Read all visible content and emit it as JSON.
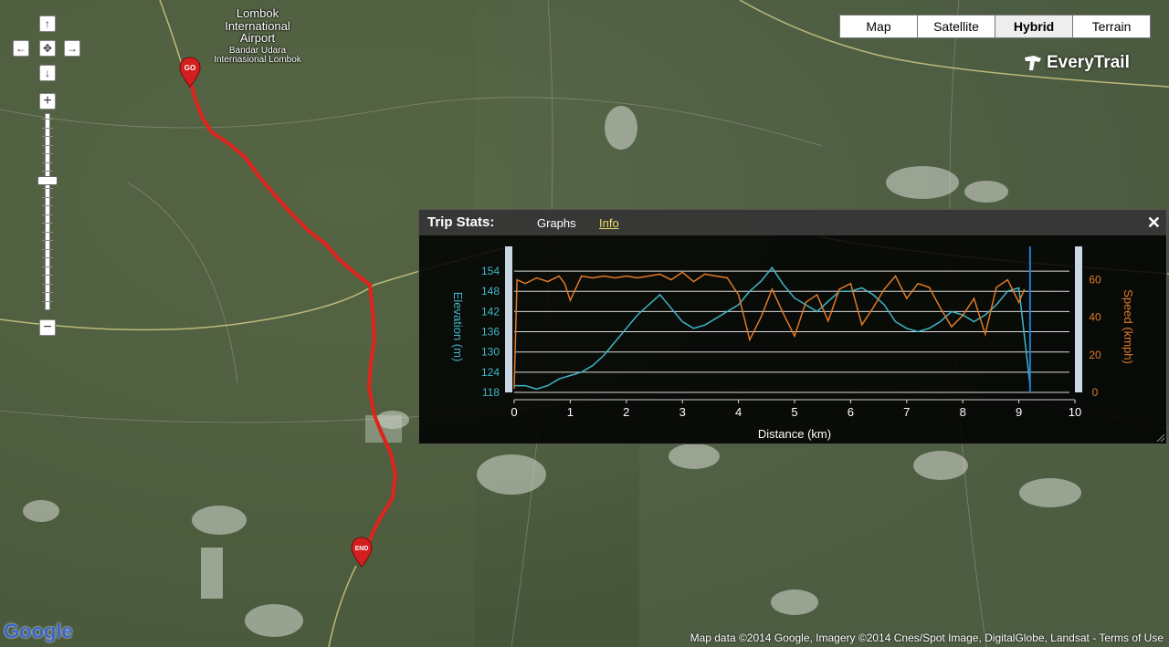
{
  "map": {
    "airport_name": "Lombok International Airport",
    "airport_name_local": "Bandar Udara Internasional Lombok",
    "start_pin": "GO",
    "end_pin": "END",
    "route_color": "#e0231c"
  },
  "map_types": [
    {
      "label": "Map",
      "active": false
    },
    {
      "label": "Satellite",
      "active": false
    },
    {
      "label": "Hybrid",
      "active": true
    },
    {
      "label": "Terrain",
      "active": false
    }
  ],
  "brand": "EveryTrail",
  "panel": {
    "title": "Trip Stats:",
    "tab_graphs": "Graphs",
    "tab_info": "Info",
    "close": "✕"
  },
  "attribution": {
    "text": "Map data ©2014  Google, Imagery ©2014  Cnes/Spot Image, DigitalGlobe, Landsat - ",
    "terms": "Terms of Use"
  },
  "google_logo": "Google",
  "icons": [
    "pan-up-icon",
    "pan-left-icon",
    "pan-center-icon",
    "pan-right-icon",
    "pan-down-icon",
    "zoom-in-icon",
    "zoom-out-icon",
    "close-icon"
  ],
  "chart_data": {
    "type": "line",
    "xlabel": "Distance (km)",
    "ylabel": "Elevation (m)",
    "y2label": "Speed (kmph)",
    "xlim": [
      0,
      10
    ],
    "ylim": [
      118,
      157
    ],
    "y2lim": [
      0,
      70
    ],
    "x_ticks": [
      "0",
      "1",
      "2",
      "3",
      "4",
      "5",
      "6",
      "7",
      "8",
      "9",
      "10"
    ],
    "y_ticks": [
      "118",
      "124",
      "130",
      "136",
      "142",
      "148",
      "154"
    ],
    "y2_ticks": [
      "0",
      "20",
      "40",
      "60"
    ],
    "marker_x": 9.2,
    "colors": {
      "elevation": "#3fb6c8",
      "speed": "#e07a2a",
      "marker": "#1f7fd6"
    },
    "series": [
      {
        "name": "Elevation (m)",
        "axis": "left",
        "x": [
          0,
          0.2,
          0.4,
          0.6,
          0.8,
          1.0,
          1.2,
          1.4,
          1.6,
          1.8,
          2.0,
          2.2,
          2.4,
          2.6,
          2.8,
          3.0,
          3.2,
          3.4,
          3.6,
          3.8,
          4.0,
          4.2,
          4.4,
          4.6,
          4.8,
          5.0,
          5.2,
          5.4,
          5.6,
          5.8,
          6.0,
          6.2,
          6.4,
          6.6,
          6.8,
          7.0,
          7.2,
          7.4,
          7.6,
          7.8,
          8.0,
          8.2,
          8.4,
          8.6,
          8.8,
          9.0,
          9.2
        ],
        "y": [
          120,
          120,
          119,
          120,
          122,
          123,
          124,
          126,
          129,
          133,
          137,
          141,
          144,
          147,
          143,
          139,
          137,
          138,
          140,
          142,
          144,
          148,
          151,
          155,
          150,
          146,
          144,
          142,
          145,
          148,
          148,
          149,
          147,
          144,
          139,
          137,
          136,
          137,
          139,
          142,
          141,
          139,
          141,
          144,
          148,
          149,
          120
        ]
      },
      {
        "name": "Speed (kmph)",
        "axis": "right",
        "x": [
          0,
          0.05,
          0.2,
          0.4,
          0.6,
          0.8,
          0.9,
          1.0,
          1.2,
          1.4,
          1.6,
          1.8,
          2.0,
          2.2,
          2.4,
          2.6,
          2.8,
          3.0,
          3.2,
          3.4,
          3.6,
          3.8,
          4.0,
          4.2,
          4.4,
          4.6,
          4.8,
          5.0,
          5.2,
          5.4,
          5.6,
          5.8,
          6.0,
          6.2,
          6.4,
          6.6,
          6.8,
          7.0,
          7.2,
          7.4,
          7.6,
          7.8,
          8.0,
          8.2,
          8.4,
          8.6,
          8.8,
          9.0,
          9.1
        ],
        "y": [
          2,
          60,
          58,
          61,
          59,
          62,
          58,
          49,
          62,
          61,
          62,
          61,
          62,
          61,
          62,
          63,
          60,
          64,
          59,
          63,
          62,
          61,
          52,
          28,
          40,
          55,
          42,
          30,
          48,
          52,
          38,
          55,
          58,
          36,
          45,
          55,
          62,
          50,
          58,
          56,
          45,
          35,
          41,
          50,
          31,
          56,
          60,
          48,
          55
        ]
      }
    ]
  }
}
